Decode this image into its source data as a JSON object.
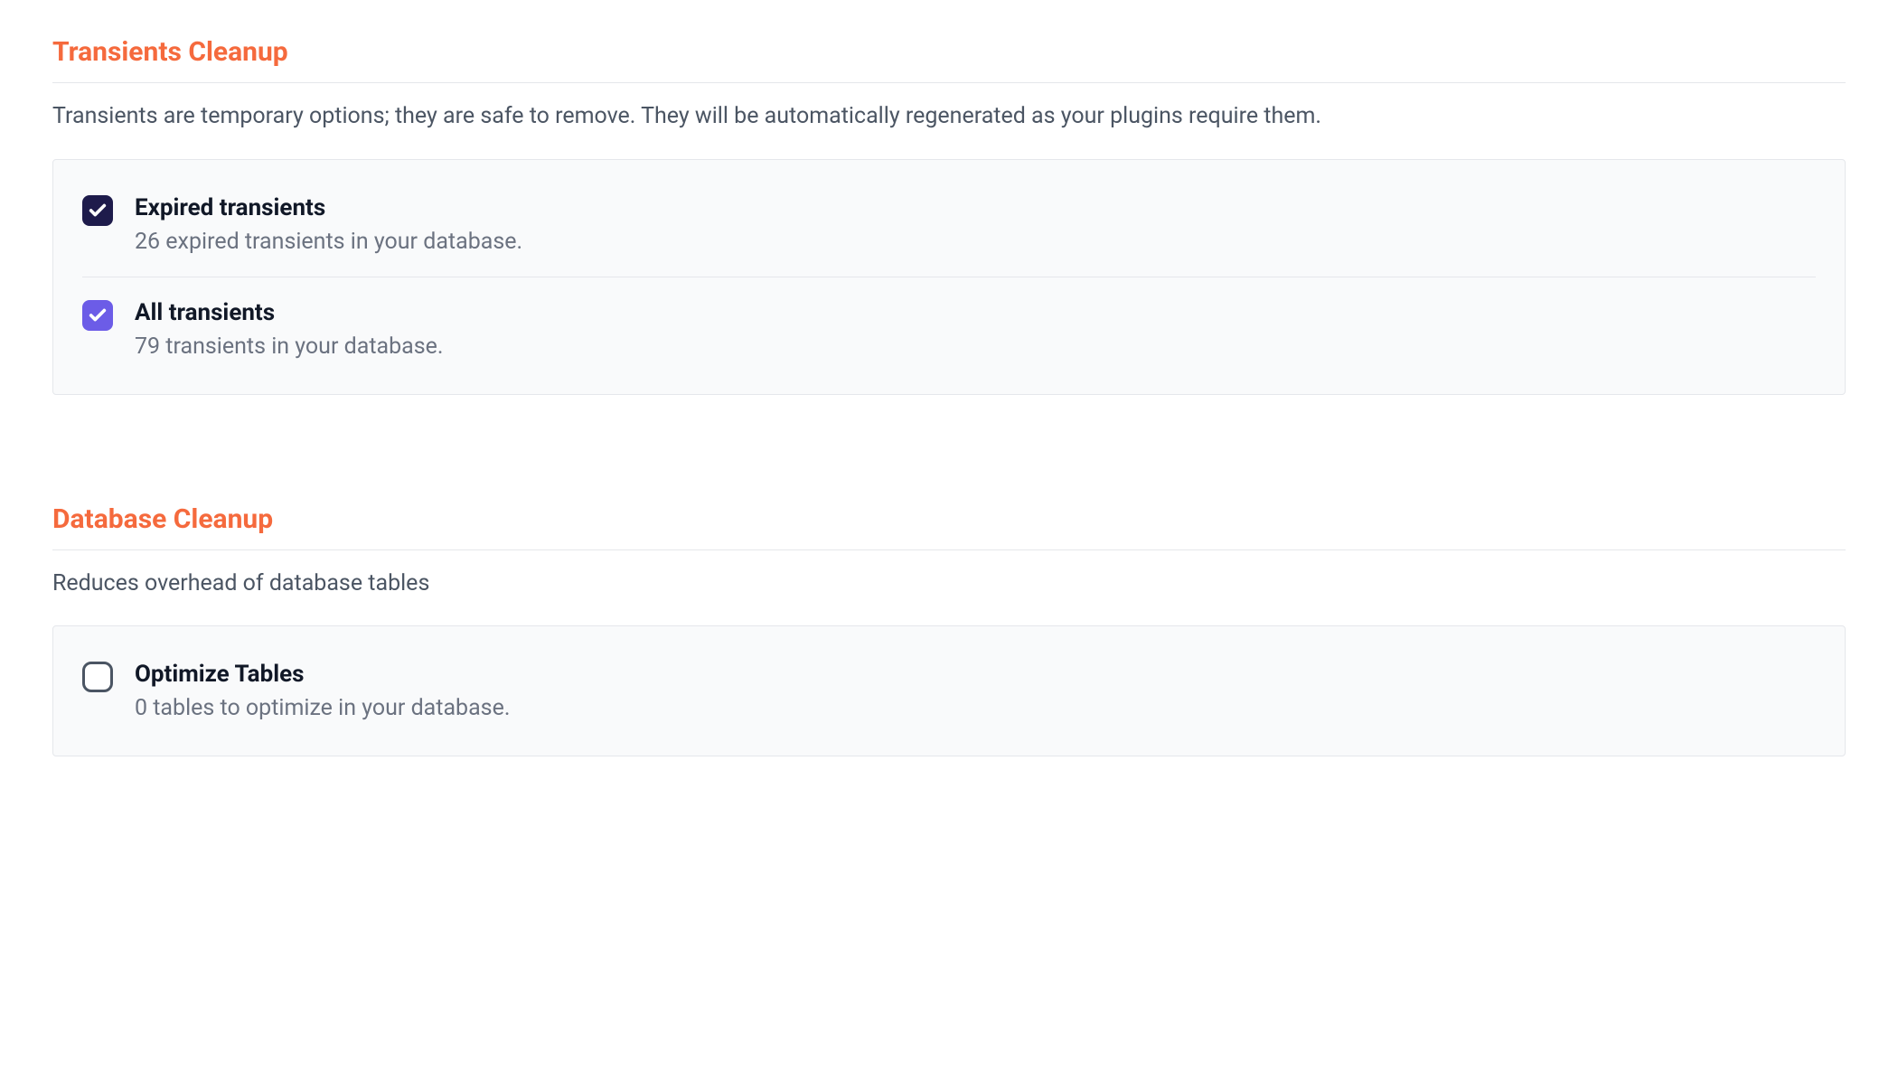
{
  "sections": [
    {
      "title": "Transients Cleanup",
      "description": "Transients are temporary options; they are safe to remove. They will be automatically regenerated as your plugins require them.",
      "options": [
        {
          "title": "Expired transients",
          "description": "26 expired transients in your database.",
          "checked": true,
          "checkbox_style": "dark"
        },
        {
          "title": "All transients",
          "description": "79 transients in your database.",
          "checked": true,
          "checkbox_style": "purple"
        }
      ]
    },
    {
      "title": "Database Cleanup",
      "description": "Reduces overhead of database tables",
      "options": [
        {
          "title": "Optimize Tables",
          "description": "0 tables to optimize in your database.",
          "checked": false,
          "checkbox_style": "empty"
        }
      ]
    }
  ]
}
